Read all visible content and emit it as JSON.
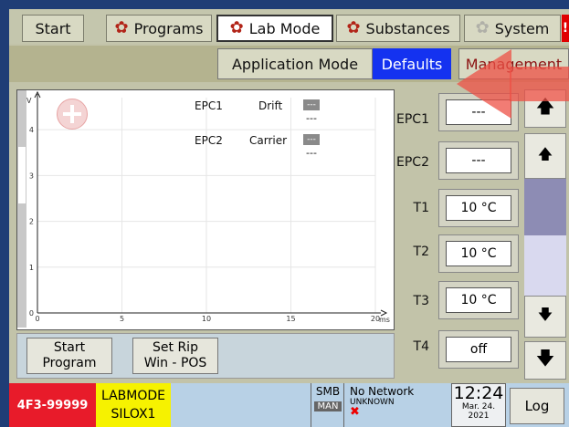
{
  "tabs": {
    "start": "Start",
    "programs": "Programs",
    "lab_mode": "Lab Mode",
    "substances": "Substances",
    "system": "System",
    "alert": "!"
  },
  "subtabs": {
    "application_mode": "Application Mode",
    "defaults": "Defaults",
    "management": "Management"
  },
  "chart": {
    "epc1": "EPC1",
    "drift": "Drift",
    "epc2": "EPC2",
    "carrier": "Carrier",
    "box_val": "---",
    "dash1": "---",
    "dash2": "---"
  },
  "chart_data": {
    "type": "line",
    "xlabel": "ms",
    "ylabel": "V",
    "x_ticks": [
      "0",
      "5",
      "10",
      "15",
      "20"
    ],
    "y_ticks": [
      "0",
      "1",
      "2",
      "3",
      "4"
    ],
    "xlim": [
      0,
      20
    ],
    "ylim": [
      0,
      4.7
    ],
    "series": []
  },
  "buttons": {
    "start_program_1": "Start",
    "start_program_2": "Program",
    "set_rip_1": "Set Rip",
    "set_rip_2": "Win - POS"
  },
  "right_panel": {
    "rows": [
      {
        "label": "EPC1",
        "value": "---"
      },
      {
        "label": "EPC2",
        "value": "---"
      },
      {
        "label": "T1",
        "value": "10 °C"
      },
      {
        "label": "T2",
        "value": "10 °C"
      },
      {
        "label": "T3",
        "value": "10 °C"
      },
      {
        "label": "T4",
        "value": "off"
      }
    ]
  },
  "status": {
    "device_id": "4F3-99999",
    "mode": "LABMODE",
    "substance": "SILOX1",
    "smb": "SMB",
    "man": "MAN",
    "network": "No Network",
    "network_status": "UNKNOWN",
    "time": "12:24",
    "date1": "Mar. 24.",
    "date2": "2021",
    "log": "Log"
  },
  "colors": {
    "accent_blue": "#1432f0",
    "alert_red": "#e81b2a",
    "status_yellow": "#f6f200"
  }
}
